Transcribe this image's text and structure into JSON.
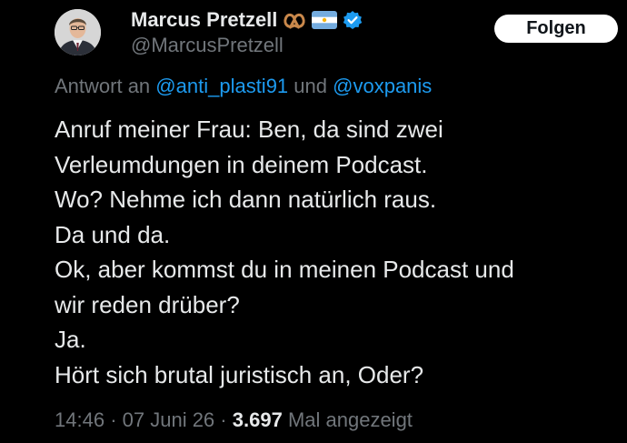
{
  "author": {
    "display_name": "Marcus Pretzell",
    "handle": "@MarcusPretzell",
    "name_emojis": [
      "pretzel-icon",
      "argentina-flag-icon",
      "verified-badge-icon"
    ]
  },
  "follow_button": {
    "label": "Folgen"
  },
  "reply_context": {
    "prefix": "Antwort an",
    "mention_1": "@anti_plasti91",
    "connector": "und",
    "mention_2": "@voxpanis"
  },
  "tweet": {
    "lines": [
      "Anruf meiner Frau: Ben, da sind zwei",
      "Verleumdungen in deinem Podcast.",
      "Wo? Nehme ich dann natürlich raus.",
      "Da und da.",
      "Ok, aber kommst du in meinen Podcast und",
      "wir reden drüber?",
      "Ja.",
      "Hört sich brutal juristisch an, Oder?"
    ]
  },
  "meta": {
    "time": "14:46",
    "separator": "·",
    "date": "07 Juni 26",
    "views_count": "3.697",
    "views_label": "Mal angezeigt"
  },
  "colors": {
    "background": "#000000",
    "text_primary": "#e7e9ea",
    "text_secondary": "#71767b",
    "link": "#1d9bf0",
    "verified": "#1d9bf0",
    "button_bg": "#ffffff",
    "button_text": "#0f1419"
  }
}
